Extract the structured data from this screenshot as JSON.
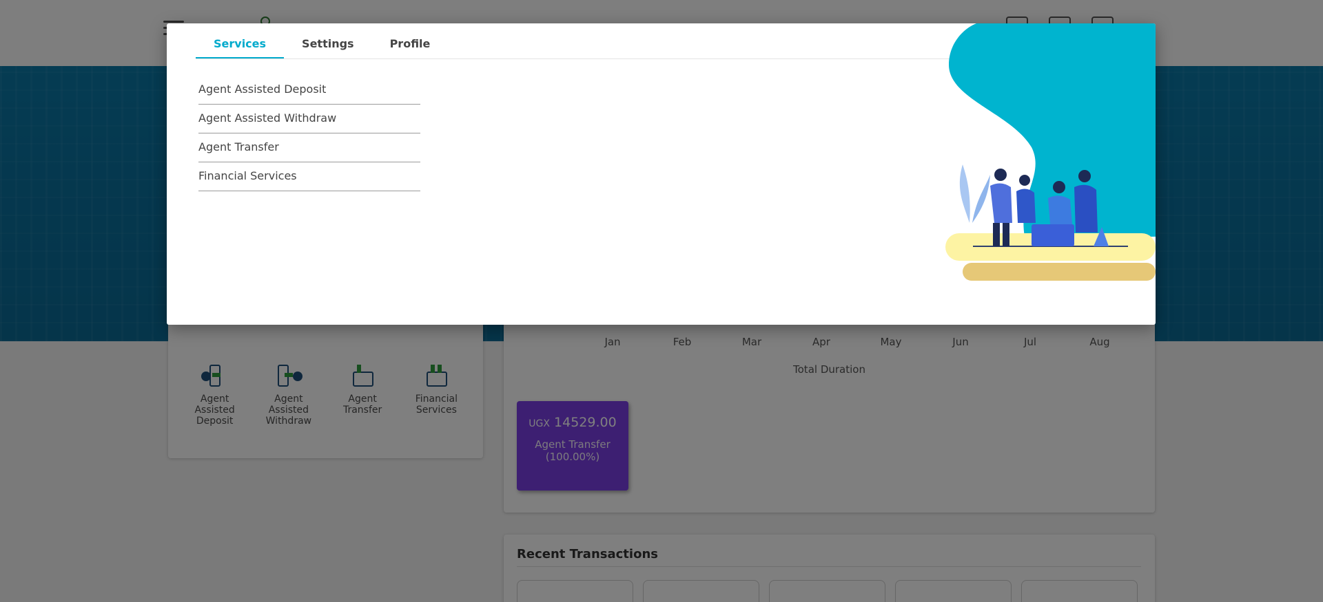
{
  "modal": {
    "tabs": [
      {
        "label": "Services",
        "active": true
      },
      {
        "label": "Settings",
        "active": false
      },
      {
        "label": "Profile",
        "active": false
      }
    ],
    "menu_items": [
      "Agent Assisted Deposit",
      "Agent Assisted Withdraw",
      "Agent Transfer",
      "Financial Services"
    ]
  },
  "services": [
    {
      "label": "Agent Assisted Deposit",
      "icon": "phone-deposit-icon"
    },
    {
      "label": "Agent Assisted Withdraw",
      "icon": "phone-withdraw-icon"
    },
    {
      "label": "Agent Transfer",
      "icon": "wallet-transfer-icon"
    },
    {
      "label": "Financial Services",
      "icon": "wallet-services-icon"
    }
  ],
  "chart": {
    "months": [
      "Jan",
      "Feb",
      "Mar",
      "Apr",
      "May",
      "Jun",
      "Jul",
      "Aug"
    ],
    "xlabel": "Total Duration"
  },
  "summary_tile": {
    "currency": "UGX",
    "amount": "14529.00",
    "name": "Agent Transfer",
    "percent": "(100.00%)",
    "color": "#7b3fe4"
  },
  "recent": {
    "title": "Recent Transactions"
  },
  "colors": {
    "accent": "#00aacc",
    "banner": "#0b6a95"
  }
}
